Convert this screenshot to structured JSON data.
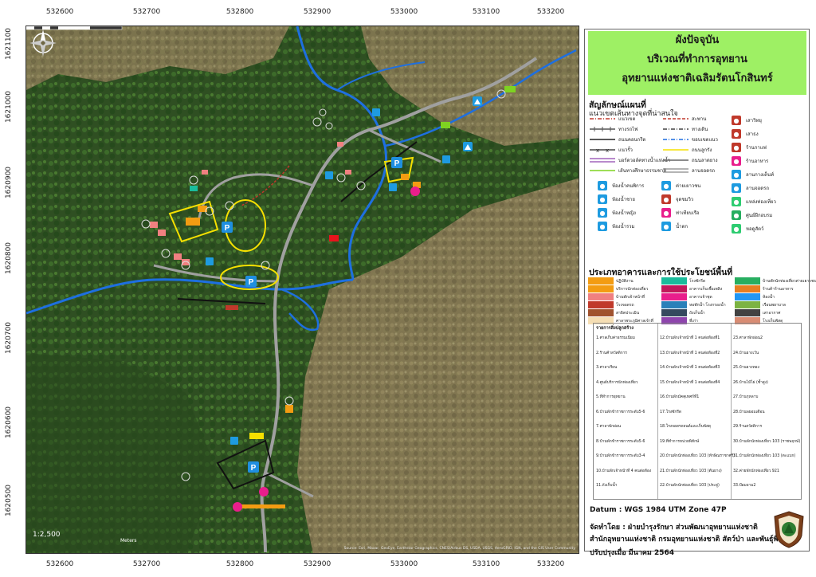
{
  "title": {
    "line1": "ผังปัจจุบัน",
    "line2": "บริเวณที่ทำการอุทยาน",
    "line3": "อุทยานแห่งชาติเฉลิมรัตนโกสินทร์"
  },
  "axes": {
    "x_ticks": [
      "532600",
      "532700",
      "532800",
      "532900",
      "533000",
      "533100",
      "533200"
    ],
    "y_ticks": [
      "1621100",
      "1621000",
      "1620900",
      "1620800",
      "1620700",
      "1620600",
      "1620500"
    ]
  },
  "map": {
    "scale": "1:2,500",
    "scale_unit": "Meters",
    "attribution": "Source: Esri, Maxar, GeoEye, Earthstar Geographics, CNES/Airbus DS, USDA, USGS, AeroGRID, IGN, and the GIS User Community",
    "north_label": "N",
    "colors": {
      "river": "#1e6fe0",
      "road": "#9a9a9a",
      "trail": "#c0392b",
      "parking_outline": "#f5e000",
      "parking_icon": "#1f8fe0"
    }
  },
  "legend": {
    "heading": "สัญลักษณ์แผนที่",
    "subheading": "แนวเขตเส้นทางจุดที่น่าสนใจ",
    "lines": [
      {
        "label": "แนวเขต",
        "color": "#c0392b",
        "style": "dashdot"
      },
      {
        "label": "ทางรถไฟ",
        "color": "#555555",
        "style": "rail"
      },
      {
        "label": "ถนนคอนกรีต",
        "color": "#222222",
        "style": "solid"
      },
      {
        "label": "แนวรั้ว",
        "color": "#222222",
        "style": "fence"
      },
      {
        "label": "บอร์ดวอล์คทางน้ำแห่งน้ำ",
        "color": "#8e44ad",
        "style": "double"
      },
      {
        "label": "เส้นทางศึกษาธรรมชาติ",
        "color": "#7ed321",
        "style": "solid"
      },
      {
        "label": "สะพาน",
        "color": "#c0392b",
        "style": "dash"
      },
      {
        "label": "ทางเดิน",
        "color": "#444444",
        "style": "dashdot"
      },
      {
        "label": "ขอบเขตแนว",
        "color": "#1e6fe0",
        "style": "dashdot"
      },
      {
        "label": "ถนนลูกรัง",
        "color": "#f5e000",
        "style": "solid"
      },
      {
        "label": "ถนนลาดยาง",
        "color": "#666666",
        "style": "solid"
      },
      {
        "label": "ลานจอดรถ",
        "color": "#888888",
        "style": "double"
      }
    ],
    "points_col3": [
      {
        "label": "เสาวิทยุ",
        "color": "#c0392b",
        "icon": "antenna-icon"
      },
      {
        "label": "เสาธง",
        "color": "#c0392b",
        "icon": "flag-icon"
      },
      {
        "label": "ร้านกาแฟ",
        "color": "#c0392b",
        "icon": "coffee-icon"
      },
      {
        "label": "ร้านอาหาร",
        "color": "#e91e8c",
        "icon": "restaurant-icon"
      },
      {
        "label": "ลานกางเต็นท์",
        "color": "#1e9be0",
        "icon": "tent-icon"
      },
      {
        "label": "ลานจอดรถ",
        "color": "#1e9be0",
        "icon": "parking-icon"
      },
      {
        "label": "แหล่งท่องเที่ยว",
        "color": "#2ecc71",
        "icon": "attraction-icon"
      },
      {
        "label": "ศูนย์ฝึกอบรม",
        "color": "#27ae60",
        "icon": "training-icon"
      },
      {
        "label": "หอดูสัตว์",
        "color": "#2ecc71",
        "icon": "watchtower-icon"
      }
    ],
    "points": [
      {
        "label": "ห้องน้ำคนพิการ",
        "color": "#1e9be0",
        "icon": "accessible-toilet-icon"
      },
      {
        "label": "ค่ายเยาวชน",
        "color": "#1e9be0",
        "icon": "youth-camp-icon"
      },
      {
        "label": "ห้องน้ำชาย",
        "color": "#1e9be0",
        "icon": "male-toilet-icon"
      },
      {
        "label": "จุดชมวิว",
        "color": "#c0392b",
        "icon": "viewpoint-icon"
      },
      {
        "label": "ห้องน้ำหญิง",
        "color": "#1e9be0",
        "icon": "female-toilet-icon"
      },
      {
        "label": "ท่าเทียบเรือ",
        "color": "#e91e8c",
        "icon": "pier-icon"
      },
      {
        "label": "ห้องน้ำรวม",
        "color": "#1e9be0",
        "icon": "toilet-icon"
      },
      {
        "label": "น้ำตก",
        "color": "#1e9be0",
        "icon": "waterfall-icon"
      }
    ]
  },
  "buildings": {
    "heading": "ประเภทอาคารและการใช้ประโยชน์พื้นที่",
    "items": [
      {
        "label": "ปฏิบัติงาน",
        "color": "#f39c12"
      },
      {
        "label": "บริการนักท่องเที่ยว",
        "color": "#f39c12"
      },
      {
        "label": "บ้านพักเจ้าหน้าที่",
        "color": "#f08080"
      },
      {
        "label": "โรงจอดรถ",
        "color": "#c0392b"
      },
      {
        "label": "สาธิตประเมิน",
        "color": "#a0522d"
      },
      {
        "label": "ศาลาพระภูมิศาลเจ้าที่",
        "color": "#f5deb3"
      },
      {
        "label": "โรงซักรีด",
        "color": "#1abc9c"
      },
      {
        "label": "อาคารเก็บเชื้อเพลิง",
        "color": "#c2185b"
      },
      {
        "label": "อาคารเจ้าชุด",
        "color": "#e91e8c"
      },
      {
        "label": "หอพักน้ำ โรงกรองน้ำ",
        "color": "#2980b9"
      },
      {
        "label": "ถังเก็บน้ำ",
        "color": "#34495e"
      },
      {
        "label": "ที่เก่า",
        "color": "#8e44ad"
      },
      {
        "label": "บ้านพักนักท่องเที่ยวค่ายเยาวชน",
        "color": "#27ae60"
      },
      {
        "label": "ร้านค้าร้านอาหาร",
        "color": "#e67e22"
      },
      {
        "label": "ห้องน้ำ",
        "color": "#2196f3"
      },
      {
        "label": "เรือนพยาบาล",
        "color": "#7cb342"
      },
      {
        "label": "เสาอากาศ",
        "color": "#424242"
      },
      {
        "label": "โรงเก็บพัสดุ",
        "color": "#d98c73"
      }
    ]
  },
  "building_list": {
    "heading": "รายการสิ่งปลูกสร้าง",
    "col1": [
      "1.ศาลเก็บค่าธรรมเนียม",
      "2.ร้านค้าสวัสดิการ",
      "3.ศาลาเรียน",
      "4.ศูนย์บริการนักท่องเที่ยว",
      "5.ที่ทำการอุทยาน",
      "6.บ้านพักข้าราชการระดับ5-6",
      "7.ศาลาพักผ่อน",
      "8.บ้านพักข้าราชการระดับ5-6",
      "9.บ้านพักข้าราชการระดับ3-4",
      "10.บ้านพักเจ้าหน้าที่ 4 คนต่อห้อง",
      "11.ถังเก็บน้ำ"
    ],
    "col2": [
      "12.บ้านพักเจ้าหน้าที่ 1 คนต่อห้องที่1",
      "13.บ้านพักเจ้าหน้าที่ 1 คนต่อห้องที่2",
      "14.บ้านพักเจ้าหน้าที่ 1 คนต่อห้องที่3",
      "15.บ้านพักเจ้าหน้าที่ 1 คนต่อห้องที่4",
      "16.บ้านพักมัคคุเทศก์ที่1",
      "17.โรงซักรีด",
      "18.โรงจอดรถยนต์และเก็บพัสดุ",
      "19.ที่ทำการหน่วยพิทักษ์",
      "20.บ้านพักนักท่องเที่ยว 103 (ทักษิณราชาศรี)",
      "21.บ้านพักนักท่องเที่ยว 103 (ต้นยาง)",
      "22.บ้านพักนักท่องเที่ยว 103 (ประดู่)"
    ],
    "col3": [
      "23.ศาลาพักผ่อน2",
      "24.บ้านยางเว้น",
      "25.บ้านยางทอง",
      "26.บ้านไม้ไผ่ (ซ้ำสูง)",
      "27.บ้านกุหลาบ",
      "28.บ้านพยอมเดือน",
      "29.ร้านสวัสดิการ",
      "30.บ้านพักนักท่องเที่ยว 103 (ราชพฤกษ์)",
      "31.บ้านพักนักท่องเที่ยว 103 (ตะแบก)",
      "32.ค่ายพักนักท่องเที่ยว 921",
      "33.ป้อมยาม2"
    ]
  },
  "info": {
    "datum": "Datum  :  WGS 1984 UTM Zone 47P",
    "made_by": "จัดทำโดย  :  ฝ่ายบำรุงรักษา ส่วนพัฒนาอุทยานแห่งชาติ",
    "office": "สำนักอุทยานแห่งชาติ  กรมอุทยานแห่งชาติ สัตว์ป่า และพันธุ์พืช",
    "updated": "ปรับปรุงเมื่อ มีนาคม 2564"
  }
}
